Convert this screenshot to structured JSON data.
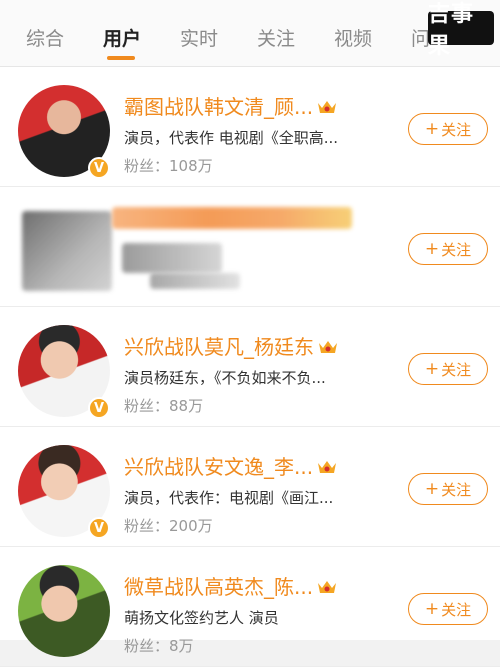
{
  "tabs": [
    {
      "label": "综合"
    },
    {
      "label": "用户"
    },
    {
      "label": "实时"
    },
    {
      "label": "关注"
    },
    {
      "label": "视频"
    },
    {
      "label": "问"
    }
  ],
  "watermark": "吉事果",
  "users": [
    {
      "name": "霸图战队韩文清_顾...",
      "desc": "演员，代表作 电视剧《全职高...",
      "fans": "粉丝：108万",
      "follow": "关注",
      "verified": true
    },
    {
      "name": "",
      "desc": "",
      "fans": "",
      "follow": "关注",
      "verified": false
    },
    {
      "name": "兴欣战队莫凡_杨廷东",
      "desc": "演员杨廷东，《不负如来不负...",
      "fans": "粉丝：88万",
      "follow": "关注",
      "verified": true
    },
    {
      "name": "兴欣战队安文逸_李...",
      "desc": "演员，代表作：电视剧《画江...",
      "fans": "粉丝：200万",
      "follow": "关注",
      "verified": true
    },
    {
      "name": "微草战队高英杰_陈...",
      "desc": "萌扬文化签约艺人 演员",
      "fans": "粉丝：8万",
      "follow": "关注",
      "verified": false
    }
  ],
  "colors": {
    "accent": "#f08a1e",
    "vip": "#f5a623"
  }
}
